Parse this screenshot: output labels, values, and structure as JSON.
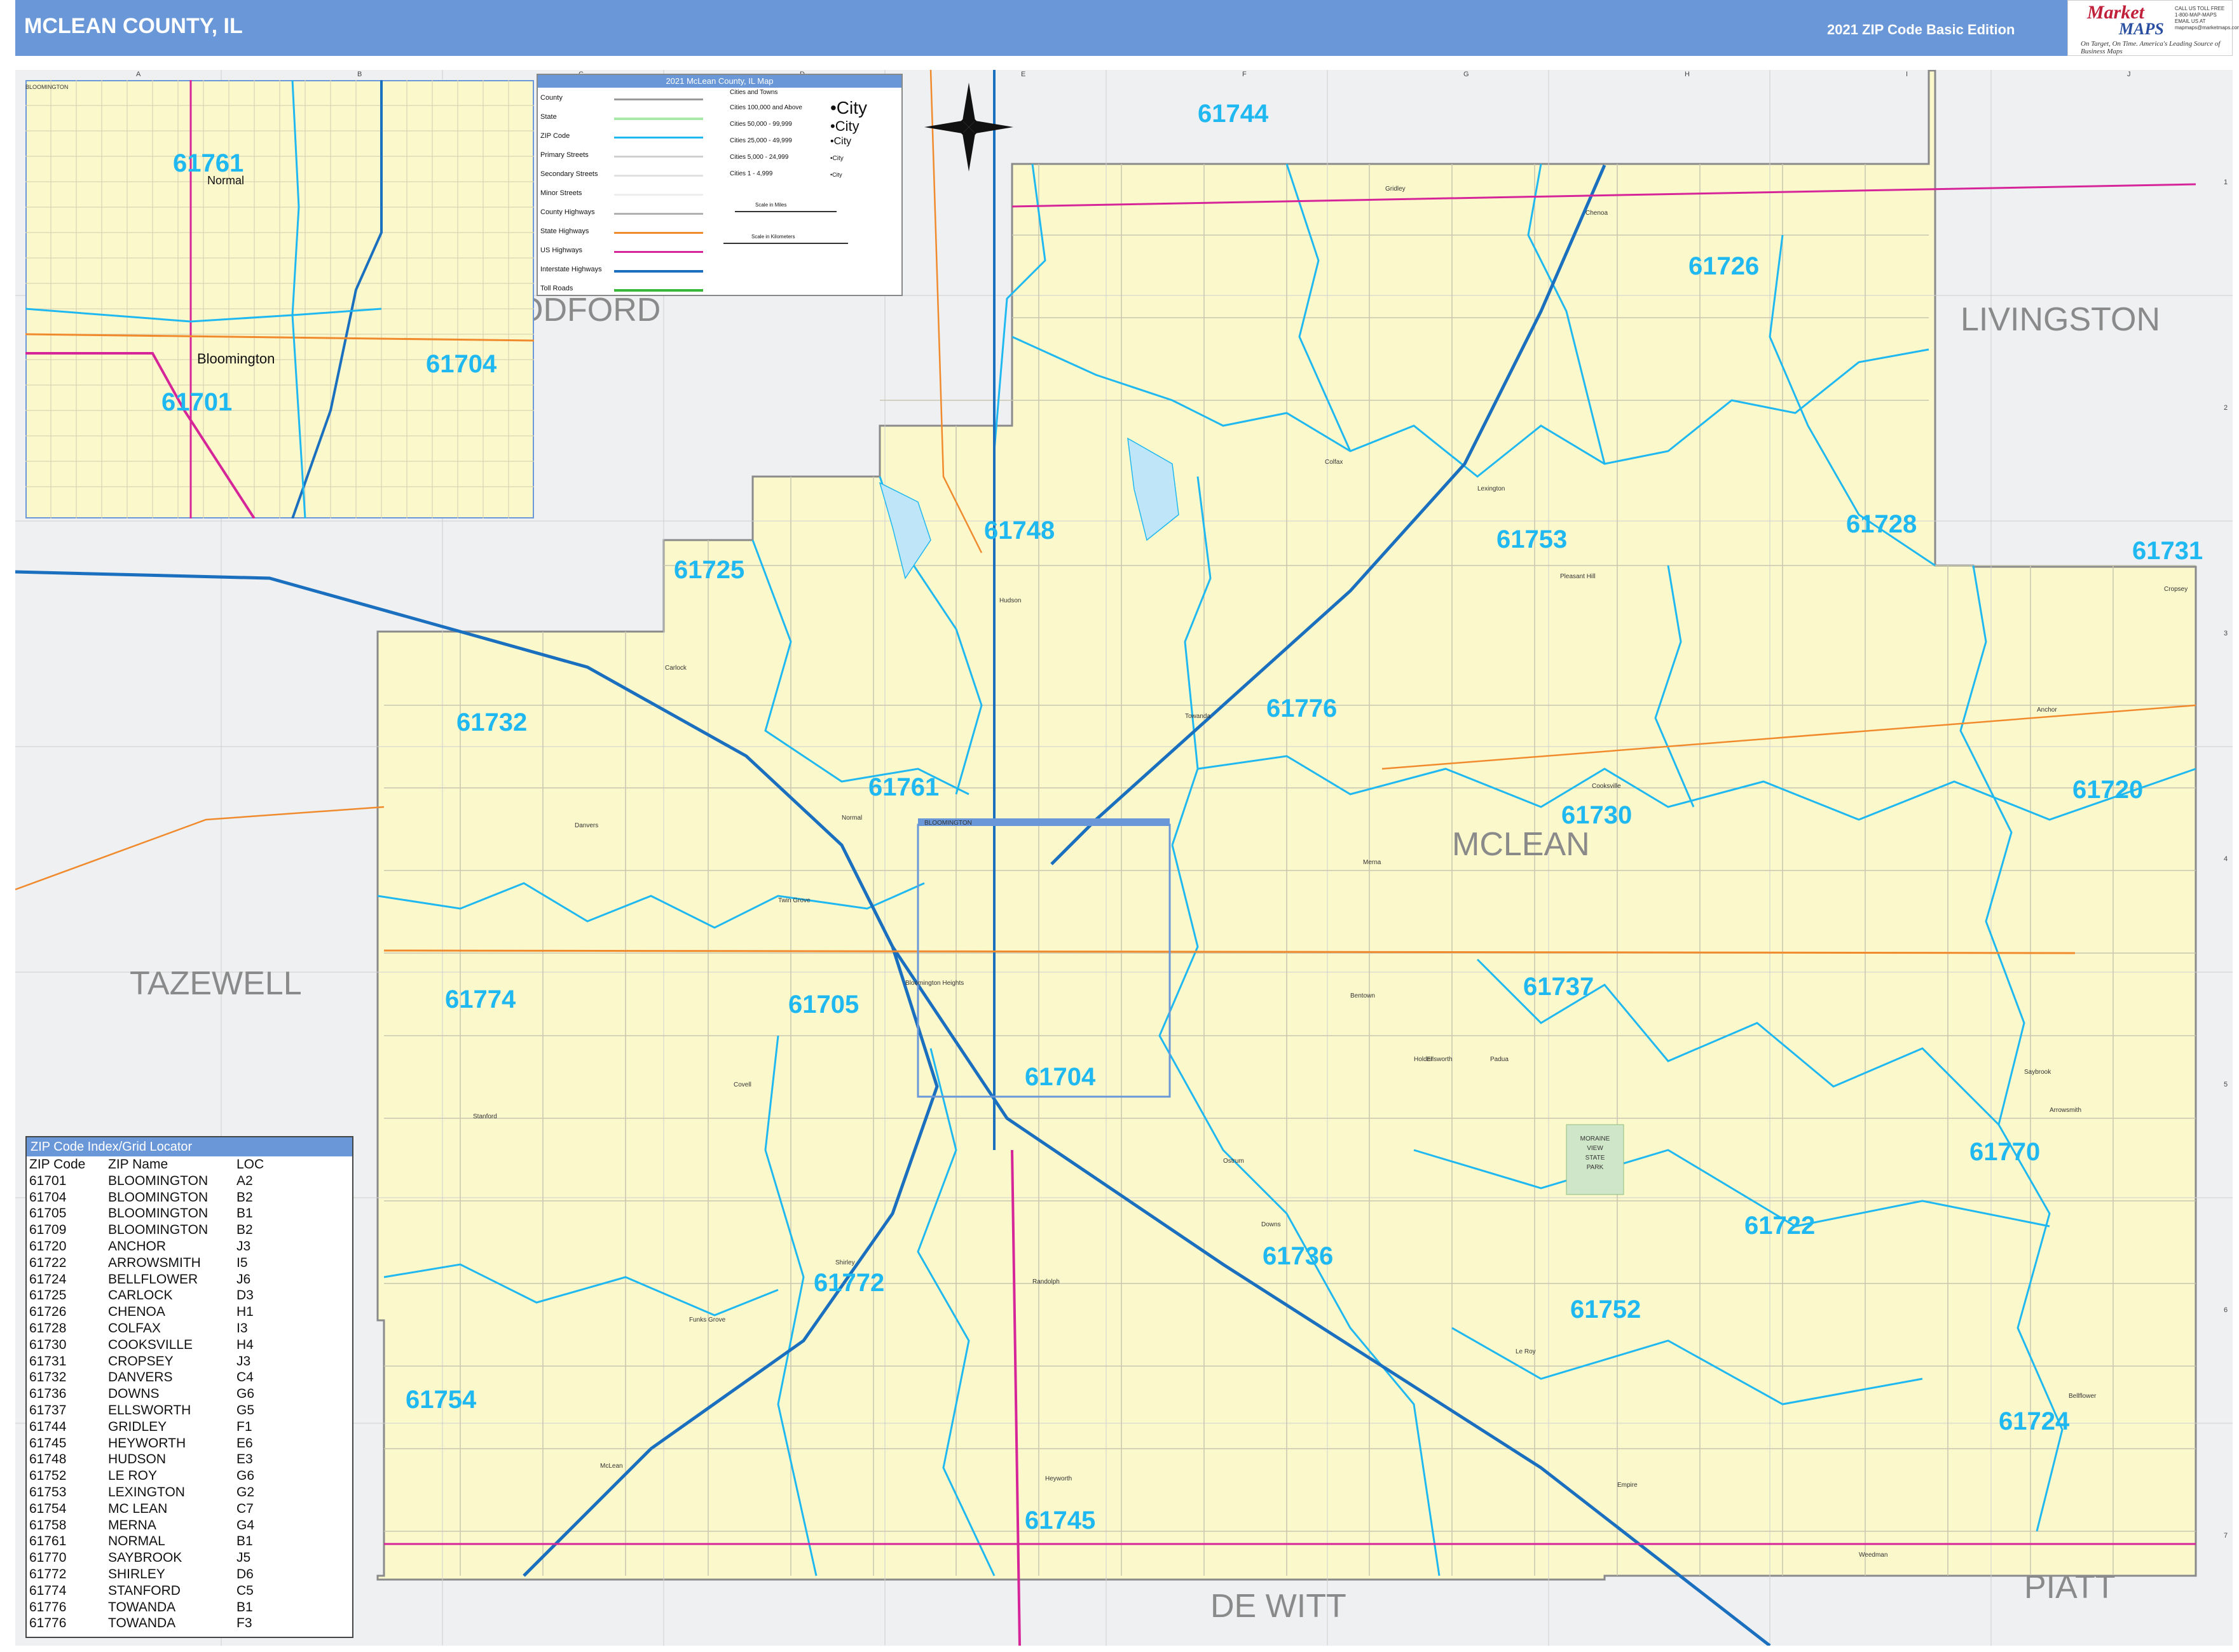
{
  "header": {
    "title": "MCLEAN COUNTY, IL",
    "edition": "2021 ZIP Code Basic Edition",
    "logo_line1": "Market",
    "logo_line2": "MAPS",
    "logo_tagline": "On Target, On Time. America's Leading Source of Business Maps",
    "logo_contact": "CALL US TOLL FREE 1-800-MAP-MAPS EMAIL US AT mapmaps@marketmaps.com"
  },
  "colors": {
    "header": "#6a97d8",
    "county_fill": "#fbf8cc",
    "zip_boundary": "#1fb8f0",
    "interstate": "#1a6fbf",
    "us_highway": "#d62598",
    "state_highway": "#f08a2c",
    "outside": "#eef0f2"
  },
  "county_labels": [
    "TAZEWELL",
    "LIVINGSTON",
    "MCLEAN",
    "DE WITT",
    "PIATT",
    "ODFORD"
  ],
  "zip_labels": [
    "61744",
    "61726",
    "61748",
    "61753",
    "61728",
    "61731",
    "61725",
    "61776",
    "61732",
    "61761",
    "61730",
    "61720",
    "61774",
    "61705",
    "61737",
    "61704",
    "61770",
    "61722",
    "61736",
    "61772",
    "61752",
    "61754",
    "61724",
    "61745"
  ],
  "inset": {
    "label": "BLOOMINGTON",
    "zips": [
      "61761",
      "61704",
      "61701"
    ],
    "towns": [
      "Normal",
      "Bloomington"
    ]
  },
  "main_inset_label": "BLOOMINGTON",
  "towns": [
    "Gridley",
    "Chenoa",
    "Lexington",
    "Hudson",
    "Towanda",
    "Carlock",
    "Danvers",
    "Normal",
    "Colfax",
    "Anchor",
    "Cooksville",
    "Merna",
    "Downs",
    "Ellsworth",
    "Arrowsmith",
    "Saybrook",
    "Bellflower",
    "Le Roy",
    "Heyworth",
    "Shirley",
    "Randolph",
    "Funks Grove",
    "McLean",
    "Stanford",
    "Bloomington Heights",
    "Twin Grove",
    "Pleasant Hill",
    "Covell",
    "Bentown",
    "Holder",
    "Padua",
    "Weedman",
    "Ostrum",
    "Cropsey",
    "Empire"
  ],
  "park_label": [
    "MORAINE",
    "VIEW",
    "STATE",
    "PARK"
  ],
  "grid": {
    "cols": [
      "A",
      "B",
      "C",
      "D",
      "E",
      "F",
      "G",
      "H",
      "I",
      "J"
    ],
    "rows": [
      "1",
      "2",
      "3",
      "4",
      "5",
      "6",
      "7"
    ]
  },
  "legend": {
    "title": "2021 McLean County, IL Map",
    "items": [
      "County",
      "State",
      "ZIP Code",
      "Primary Streets",
      "Secondary Streets",
      "Minor Streets",
      "County Highways",
      "State Highways",
      "US Highways",
      "Interstate Highways",
      "Toll Roads"
    ],
    "cities_header": "Cities and Towns",
    "cities": [
      {
        "range": "Cities 100,000 and Above",
        "sample": "•City"
      },
      {
        "range": "Cities 50,000 - 99,999",
        "sample": "•City"
      },
      {
        "range": "Cities 25,000 - 49,999",
        "sample": "•City"
      },
      {
        "range": "Cities 5,000 - 24,999",
        "sample": "•City"
      },
      {
        "range": "Cities 1 - 4,999",
        "sample": "•City"
      }
    ],
    "scale_miles": "Scale in Miles",
    "scale_km": "Scale in Kilometers"
  },
  "index": {
    "title": "ZIP Code Index/Grid Locator",
    "headers": [
      "ZIP Code",
      "ZIP Name",
      "LOC"
    ],
    "rows": [
      [
        "61701",
        "BLOOMINGTON",
        "A2"
      ],
      [
        "61704",
        "BLOOMINGTON",
        "B2"
      ],
      [
        "61705",
        "BLOOMINGTON",
        "B1"
      ],
      [
        "61709",
        "BLOOMINGTON",
        "B2"
      ],
      [
        "61720",
        "ANCHOR",
        "J3"
      ],
      [
        "61722",
        "ARROWSMITH",
        "I5"
      ],
      [
        "61724",
        "BELLFLOWER",
        "J6"
      ],
      [
        "61725",
        "CARLOCK",
        "D3"
      ],
      [
        "61726",
        "CHENOA",
        "H1"
      ],
      [
        "61728",
        "COLFAX",
        "I3"
      ],
      [
        "61730",
        "COOKSVILLE",
        "H4"
      ],
      [
        "61731",
        "CROPSEY",
        "J3"
      ],
      [
        "61732",
        "DANVERS",
        "C4"
      ],
      [
        "61736",
        "DOWNS",
        "G6"
      ],
      [
        "61737",
        "ELLSWORTH",
        "G5"
      ],
      [
        "61744",
        "GRIDLEY",
        "F1"
      ],
      [
        "61745",
        "HEYWORTH",
        "E6"
      ],
      [
        "61748",
        "HUDSON",
        "E3"
      ],
      [
        "61752",
        "LE ROY",
        "G6"
      ],
      [
        "61753",
        "LEXINGTON",
        "G2"
      ],
      [
        "61754",
        "MC LEAN",
        "C7"
      ],
      [
        "61758",
        "MERNA",
        "G4"
      ],
      [
        "61761",
        "NORMAL",
        "B1"
      ],
      [
        "61770",
        "SAYBROOK",
        "J5"
      ],
      [
        "61772",
        "SHIRLEY",
        "D6"
      ],
      [
        "61774",
        "STANFORD",
        "C5"
      ],
      [
        "61776",
        "TOWANDA",
        "B1"
      ],
      [
        "61776",
        "TOWANDA",
        "F3"
      ]
    ]
  }
}
